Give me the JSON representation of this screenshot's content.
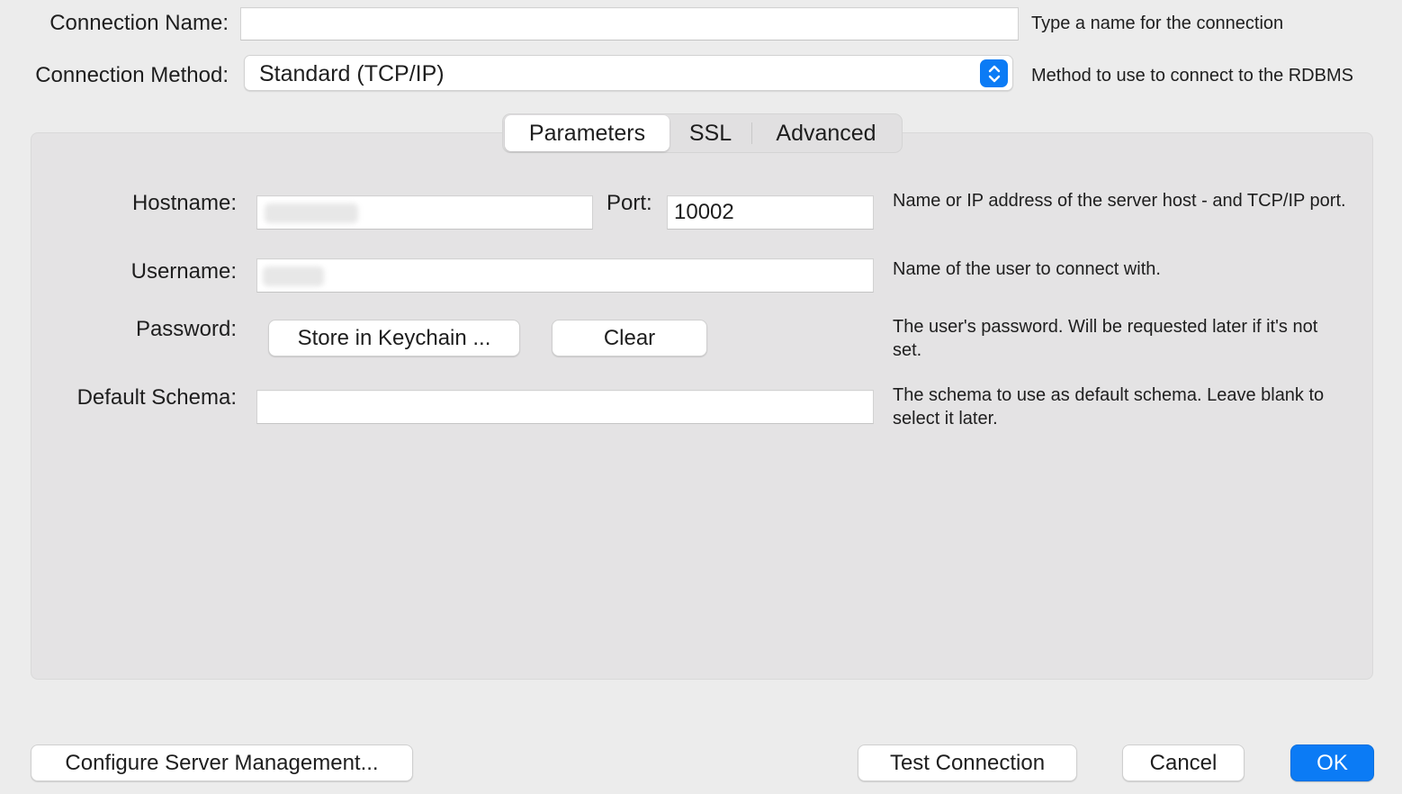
{
  "connection_name": {
    "label": "Connection Name:",
    "value": "",
    "hint": "Type a name for the connection"
  },
  "connection_method": {
    "label": "Connection Method:",
    "selected": "Standard (TCP/IP)",
    "hint": "Method to use to connect to the RDBMS"
  },
  "tabs": [
    {
      "label": "Parameters",
      "active": true
    },
    {
      "label": "SSL",
      "active": false
    },
    {
      "label": "Advanced",
      "active": false
    }
  ],
  "parameters": {
    "hostname": {
      "label": "Hostname:",
      "value": ""
    },
    "port": {
      "label": "Port:",
      "value": "10002"
    },
    "host_hint": "Name or IP address of the server host - and TCP/IP port.",
    "username": {
      "label": "Username:",
      "value": "",
      "hint": "Name of the user to connect with."
    },
    "password": {
      "label": "Password:",
      "store_button": "Store in Keychain ...",
      "clear_button": "Clear",
      "hint": "The user's password. Will be requested later if it's not set."
    },
    "default_schema": {
      "label": "Default Schema:",
      "value": "",
      "hint": "The schema to use as default schema. Leave blank to select it later."
    }
  },
  "footer": {
    "configure_button": "Configure Server Management...",
    "test_button": "Test Connection",
    "cancel_button": "Cancel",
    "ok_button": "OK"
  },
  "colors": {
    "accent": "#0b7bf5",
    "window_bg": "#ececec",
    "panel_bg": "#e4e3e4"
  }
}
